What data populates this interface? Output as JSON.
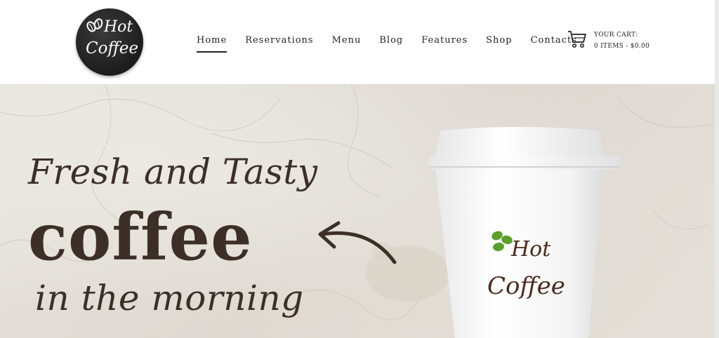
{
  "header": {
    "logo": {
      "line1": "Hot",
      "line2": "Coffee",
      "icon": "coffee-beans-icon"
    },
    "nav": [
      {
        "label": "Home",
        "active": true
      },
      {
        "label": "Reservations",
        "active": false
      },
      {
        "label": "Menu",
        "active": false
      },
      {
        "label": "Blog",
        "active": false
      },
      {
        "label": "Features",
        "active": false
      },
      {
        "label": "Shop",
        "active": false
      },
      {
        "label": "Contacts",
        "active": false
      }
    ],
    "cart": {
      "icon": "shopping-cart-icon",
      "label": "YOUR CART:",
      "summary": "0 ITEMS - $0.00"
    }
  },
  "hero": {
    "line1": "Fresh and Tasty",
    "line2": "coffee",
    "line3": "in the morning",
    "arrow_icon": "arrow-left-icon",
    "cup_brand": {
      "line1": "Hot",
      "line2": "Coffee",
      "icon": "coffee-beans-icon"
    }
  },
  "colors": {
    "text_dark": "#3c2f27",
    "brand_brown": "#4b2a1c",
    "bean_green": "#5aa02c",
    "nav_text": "#222222",
    "logo_bg": "#1d1d1d"
  }
}
